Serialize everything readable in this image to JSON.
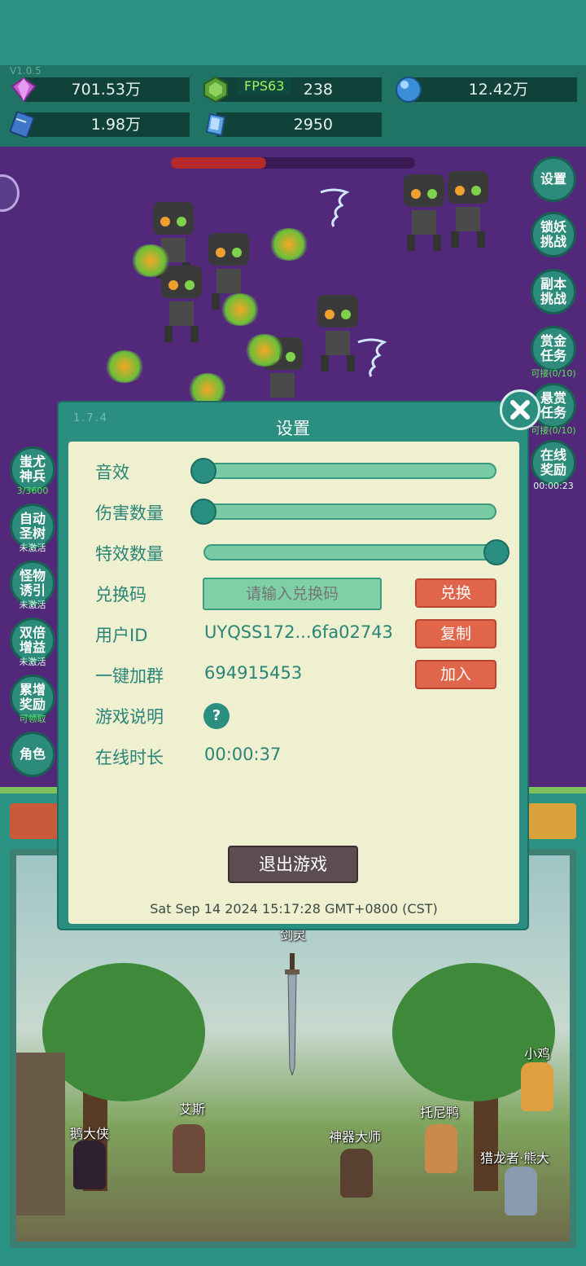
{
  "hud": {
    "version_small": "V1.0.5",
    "fps": "FPS63",
    "resources": [
      {
        "name": "diamond",
        "icon": "diamond-icon",
        "value": "701.53万",
        "color": "#c45fd6"
      },
      {
        "name": "green-gem",
        "icon": "green-gem-icon",
        "value": "238",
        "color": "#5aa33a"
      },
      {
        "name": "blue-orb",
        "icon": "blue-orb-icon",
        "value": "12.42万",
        "color": "#3b8fd8"
      },
      {
        "name": "book",
        "icon": "book-icon",
        "value": "1.98万",
        "color": "#3f78c8"
      },
      {
        "name": "crystal",
        "icon": "crystal-icon",
        "value": "2950",
        "color": "#5ea3e6"
      }
    ]
  },
  "battle": {
    "boss_hp_fraction": 0.39
  },
  "right_buttons": [
    {
      "label": "设置",
      "sub": ""
    },
    {
      "label": "锁妖\n挑战",
      "sub": ""
    },
    {
      "label": "副本\n挑战",
      "sub": ""
    },
    {
      "label": "赏金\n任务",
      "sub": "可接(0/10)"
    },
    {
      "label": "悬赏\n任务",
      "sub": "可接(0/10)"
    },
    {
      "label": "在线\n奖励",
      "sub": "00:00:23"
    }
  ],
  "left_buttons": [
    {
      "label": "蚩尤\n神兵",
      "sub": "3/3600"
    },
    {
      "label": "自动\n圣树",
      "sub": "未激活"
    },
    {
      "label": "怪物\n诱引",
      "sub": "未激活"
    },
    {
      "label": "双倍\n增益",
      "sub": "未激活"
    },
    {
      "label": "累增\n奖励",
      "sub": "可领取"
    },
    {
      "label": "角色",
      "sub": ""
    }
  ],
  "scene": {
    "heroes": [
      {
        "name": "鹅大侠"
      },
      {
        "name": "艾斯"
      },
      {
        "name": "神器大师"
      },
      {
        "name": "托尼鸭"
      },
      {
        "name": "小鸡"
      },
      {
        "name": "猎龙者·熊大"
      }
    ],
    "sword_label": "剑灵"
  },
  "settings": {
    "version": "1.7.4",
    "title": "设置",
    "sound_label": "音效",
    "sound_level": 0.0,
    "damage_label": "伤害数量",
    "damage_level": 0.0,
    "effects_label": "特效数量",
    "effects_level": 1.0,
    "redeem_label": "兑换码",
    "redeem_placeholder": "请输入兑换码",
    "redeem_button": "兑换",
    "userid_label": "用户ID",
    "userid_value": "UYQSS172...6fa02743",
    "copy_button": "复制",
    "group_label": "一键加群",
    "group_value": "694915453",
    "join_button": "加入",
    "guide_label": "游戏说明",
    "guide_icon": "?",
    "online_label": "在线时长",
    "online_value": "00:00:37",
    "exit_button": "退出游戏",
    "timestamp": "Sat Sep 14 2024 15:17:28 GMT+0800 (CST)"
  }
}
